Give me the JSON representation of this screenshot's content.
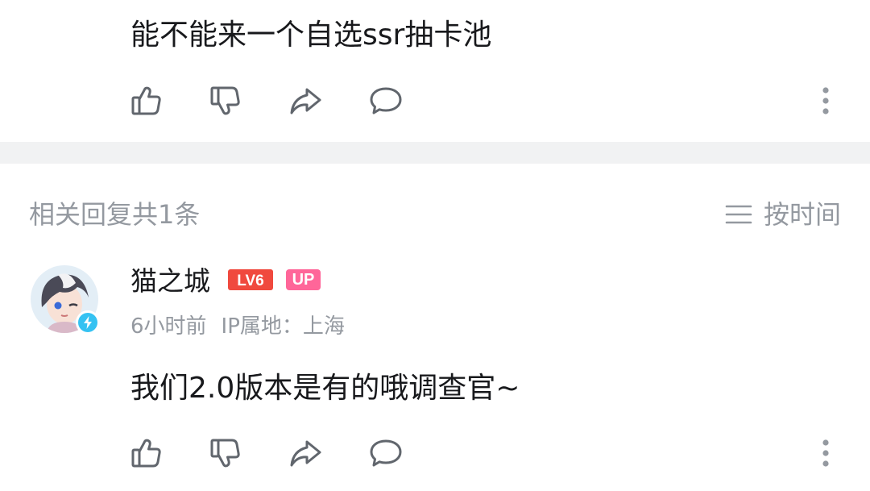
{
  "top_comment": {
    "text": "能不能来一个自选ssr抽卡池"
  },
  "reply_header": {
    "title": "相关回复共1条",
    "sort_label": "按时间",
    "sort_icon": "menu-lines-icon"
  },
  "reply": {
    "username": "猫之城",
    "level_badge": "LV6",
    "up_badge": "UP",
    "time": "6小时前",
    "ip_location": "IP属地：上海",
    "text": "我们2.0版本是有的哦调查官~",
    "avatar_badge_icon": "lightning-icon"
  },
  "actions": {
    "icons": [
      "thumbs-up-icon",
      "thumbs-down-icon",
      "share-icon",
      "comment-icon",
      "more-vertical-icon"
    ]
  },
  "colors": {
    "text_primary": "#18191c",
    "text_secondary": "#9499a0",
    "icon": "#61666d",
    "divider": "#f1f2f3",
    "level_red": "#f0493e",
    "up_pink": "#ff6699",
    "badge_blue": "#35c2f2"
  }
}
